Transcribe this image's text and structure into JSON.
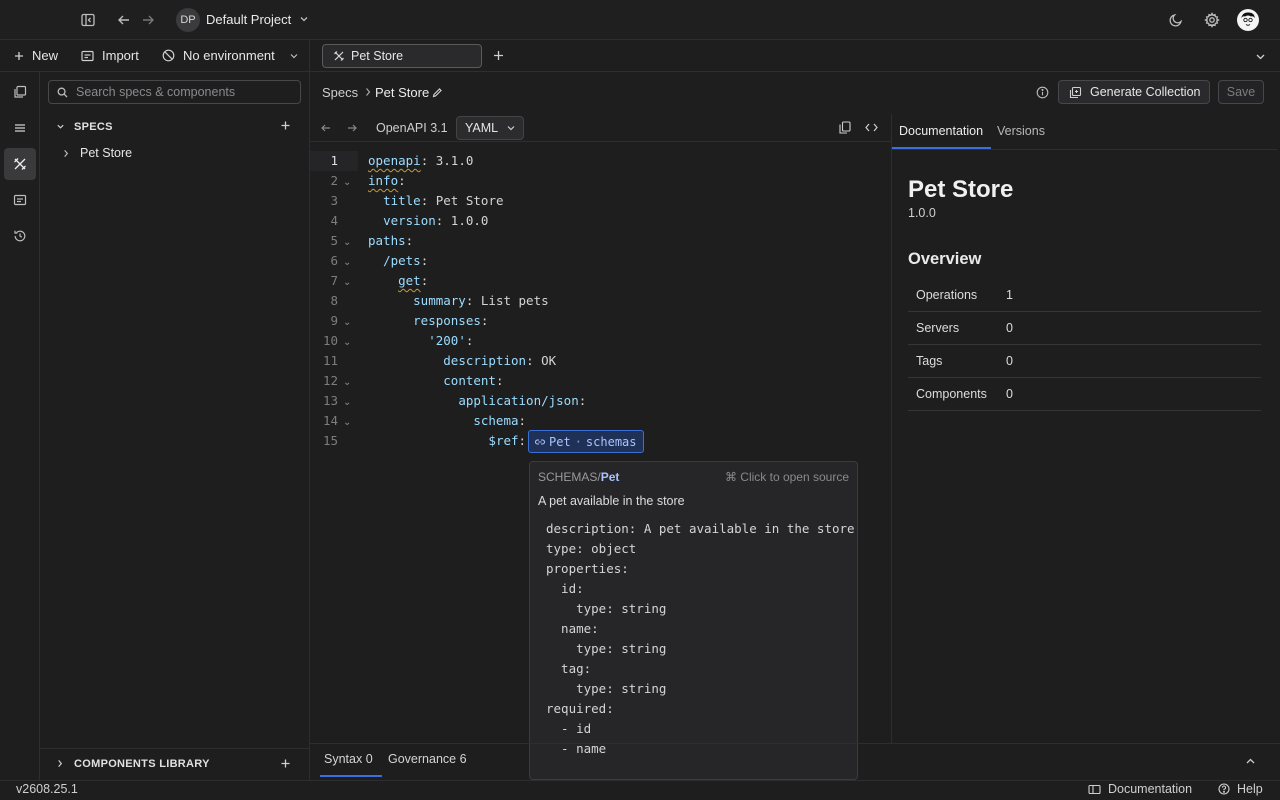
{
  "topbar": {
    "project_initials": "DP",
    "project_name": "Default Project"
  },
  "left_actions": {
    "new_label": "New",
    "import_label": "Import",
    "environment_label": "No environment"
  },
  "tabs": [
    {
      "label": "Pet Store"
    }
  ],
  "sidebar": {
    "search_placeholder": "Search specs & components",
    "specs_header": "SPECS",
    "specs_items": [
      {
        "label": "Pet Store"
      }
    ],
    "components_header": "COMPONENTS LIBRARY"
  },
  "breadcrumb": {
    "root": "Specs",
    "current": "Pet Store"
  },
  "header_actions": {
    "generate_label": "Generate Collection",
    "save_label": "Save"
  },
  "editor_toolbar": {
    "version_label": "OpenAPI 3.1",
    "format_label": "YAML"
  },
  "code_lines": [
    {
      "n": "1",
      "indent": "",
      "key": "openapi",
      "value": " 3.1.0"
    },
    {
      "n": "2",
      "indent": "",
      "key": "info",
      "value": ""
    },
    {
      "n": "3",
      "indent": "  ",
      "key": "title",
      "value": " Pet Store"
    },
    {
      "n": "4",
      "indent": "  ",
      "key": "version",
      "value": " 1.0.0"
    },
    {
      "n": "5",
      "indent": "",
      "key": "paths",
      "value": ""
    },
    {
      "n": "6",
      "indent": "  ",
      "key": "/pets",
      "value": ""
    },
    {
      "n": "7",
      "indent": "    ",
      "key": "get",
      "value": ""
    },
    {
      "n": "8",
      "indent": "      ",
      "key": "summary",
      "value": " List pets"
    },
    {
      "n": "9",
      "indent": "      ",
      "key": "responses",
      "value": ""
    },
    {
      "n": "10",
      "indent": "        ",
      "key": "'200'",
      "value": ""
    },
    {
      "n": "11",
      "indent": "          ",
      "key": "description",
      "value": " OK"
    },
    {
      "n": "12",
      "indent": "          ",
      "key": "content",
      "value": ""
    },
    {
      "n": "13",
      "indent": "            ",
      "key": "application/json",
      "value": ""
    },
    {
      "n": "14",
      "indent": "              ",
      "key": "schema",
      "value": ""
    },
    {
      "n": "15",
      "indent": "                ",
      "key": "$ref",
      "value": ""
    }
  ],
  "ref_chip": {
    "name": "Pet",
    "sep": "·",
    "kind": "schemas"
  },
  "hover_card": {
    "path_prefix": "SCHEMAS/",
    "path_name": "Pet",
    "hint": "⌘ Click to open source",
    "description": "A pet available in the store",
    "lines": [
      "description: A pet available in the store",
      "type: object",
      "properties:",
      "  id:",
      "    type: string",
      "  name:",
      "    type: string",
      "  tag:",
      "    type: string",
      "required:",
      "  - id",
      "  - name"
    ]
  },
  "docs": {
    "tab_documentation": "Documentation",
    "tab_versions": "Versions",
    "title": "Pet Store",
    "version": "1.0.0",
    "overview_title": "Overview",
    "overview": [
      {
        "label": "Operations",
        "value": "1"
      },
      {
        "label": "Servers",
        "value": "0"
      },
      {
        "label": "Tags",
        "value": "0"
      },
      {
        "label": "Components",
        "value": "0"
      }
    ]
  },
  "bottom_panel": {
    "syntax_label": "Syntax",
    "syntax_count": "0",
    "governance_label": "Governance",
    "governance_count": "6"
  },
  "statusbar": {
    "version": "v2608.25.1",
    "documentation_label": "Documentation",
    "help_label": "Help"
  },
  "colors": {
    "accent": "#3b6ee0",
    "background": "#1e1e1f",
    "key": "#9cdcfe"
  }
}
